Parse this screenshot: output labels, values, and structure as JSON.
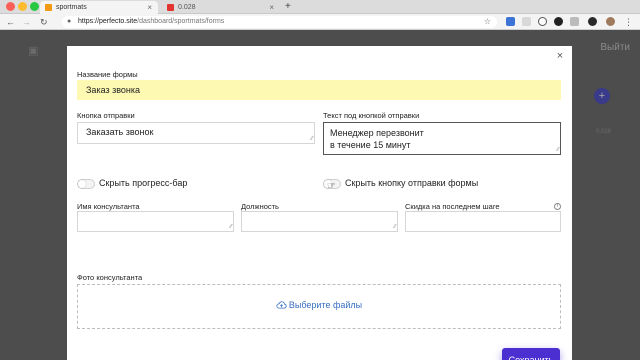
{
  "browser": {
    "tabs": [
      {
        "title": "sportmats",
        "favicon_color": "#f29a13"
      },
      {
        "title": "0.028",
        "favicon_color": "#e2352f"
      }
    ],
    "url_host": "https://perfecto.site",
    "url_path": "/dashboard/sportmats/forms",
    "icons": {
      "back": "←",
      "forward": "→",
      "reload": "↻",
      "lock": "🔒",
      "star": "☆",
      "new_tab": "+",
      "close_tab": "×"
    }
  },
  "background": {
    "exit_label": "Выйти",
    "fab_label": "+",
    "faint_text": "0.028"
  },
  "modal": {
    "close_label": "×",
    "form_name": {
      "label": "Название формы",
      "value": "Заказ звонка"
    },
    "submit_button_text": {
      "label": "Кнопка отправки",
      "value": "Заказать звонок"
    },
    "text_under_button": {
      "label": "Текст под кнопкой отправки",
      "value_line1": "Менеджер перезвонит",
      "value_line2": "в течение 15 минут"
    },
    "hide_progress": {
      "label": "Скрыть прогресс-бар",
      "on": false
    },
    "hide_submit": {
      "label": "Скрыть кнопку отправки формы",
      "on": false
    },
    "consultant_name": {
      "label": "Имя консультанта",
      "value": ""
    },
    "position": {
      "label": "Должность",
      "value": ""
    },
    "discount": {
      "label": "Скидка на последнем шаге",
      "value": ""
    },
    "photo": {
      "label": "Фото консультанта",
      "choose_files": "Выберите файлы"
    },
    "save_label": "Сохранить"
  },
  "colors": {
    "accent": "#4b2fd1",
    "link": "#3a6fc4",
    "highlight": "#fdf9b3"
  }
}
